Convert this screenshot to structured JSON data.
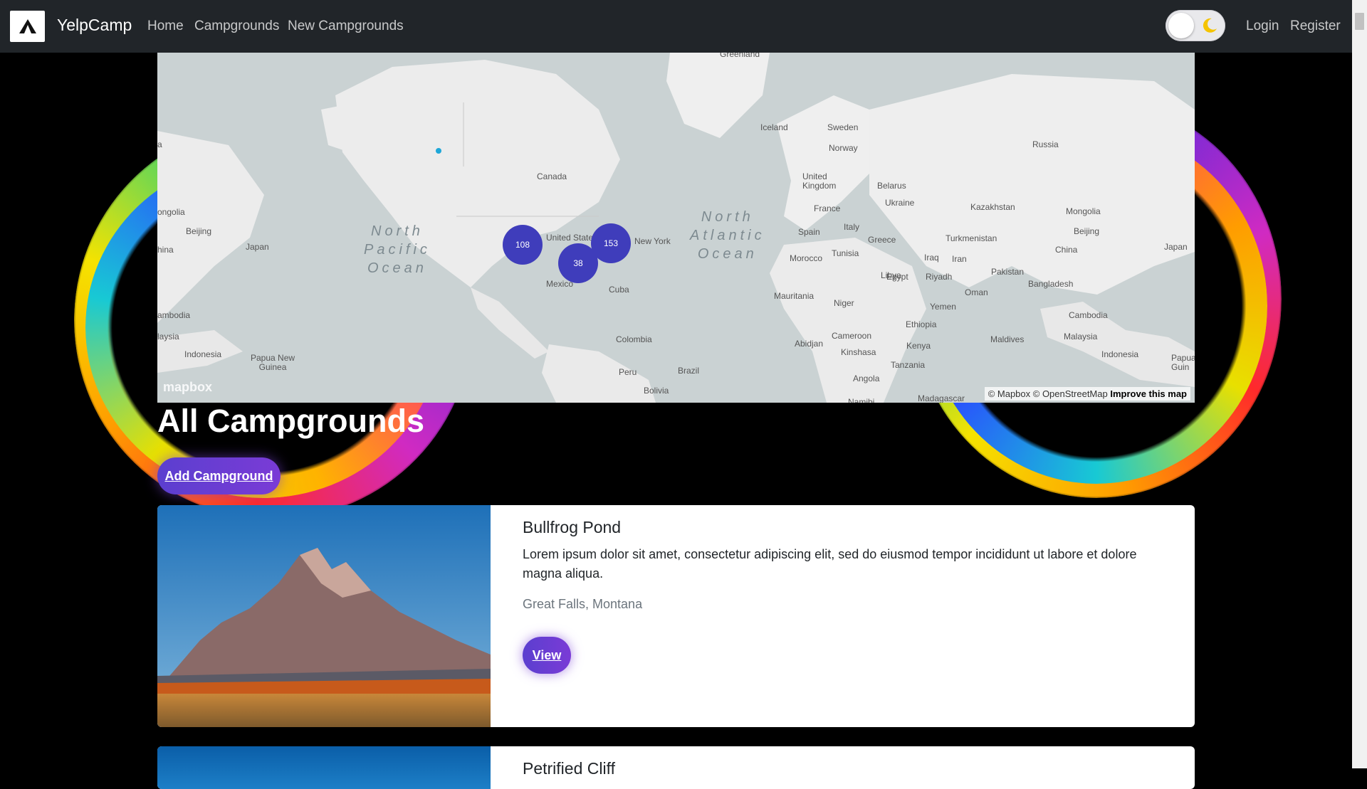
{
  "navbar": {
    "brand": "YelpCamp",
    "links": [
      "Home",
      "Campgrounds",
      "New Campgrounds"
    ],
    "login": "Login",
    "register": "Register",
    "logo_icon": "tent-icon",
    "theme_toggle_icon": "moon-icon"
  },
  "map": {
    "place_labels": {
      "greenland": "Greenland",
      "iceland": "Iceland",
      "sweden": "Sweden",
      "norway": "Norway",
      "russia": "Russia",
      "canada": "Canada",
      "uk": "United\nKingdom",
      "belarus": "Belarus",
      "ukraine": "Ukraine",
      "kazakhstan": "Kazakhstan",
      "mongolia_r": "Mongolia",
      "mongolia_l": "ongolia",
      "france": "France",
      "italy": "Italy",
      "spain": "Spain",
      "greece": "Greece",
      "turkmenistan": "Turkmenistan",
      "beijing_r": "Beijing",
      "beijing_l": "Beijing",
      "japan_r": "Japan",
      "japan_l": "Japan",
      "china_r": "China",
      "china_l": "hina",
      "united_states": "United State",
      "new_york": "New York",
      "morocco": "Morocco",
      "tunisia": "Tunisia",
      "iraq": "Iraq",
      "iran": "Iran",
      "pakistan": "Pakistan",
      "mexico": "Mexico",
      "cuba": "Cuba",
      "libya": "Libya",
      "egypt": "Egypt",
      "riyadh": "Riyadh",
      "oman": "Oman",
      "bangladesh": "Bangladesh",
      "mauritania": "Mauritania",
      "niger": "Niger",
      "yemen": "Yemen",
      "cambodia_r": "Cambodia",
      "cambodia_l": "ambodia",
      "ethiopia": "Ethiopia",
      "colombia": "Colombia",
      "cameroon": "Cameroon",
      "abidjan": "Abidjan",
      "kenya": "Kenya",
      "maldives": "Maldives",
      "malaysia_r": "Malaysia",
      "malaysia_l": "laysia",
      "indonesia_l": "Indonesia",
      "indonesia_r": "Indonesia",
      "papua_l": "Papua New\nGuinea",
      "papua_r": "Papua\nGuin",
      "kinshasa": "Kinshasa",
      "tanzania": "Tanzania",
      "peru": "Peru",
      "brazil": "Brazil",
      "bolivia": "Bolivia",
      "angola": "Angola",
      "madagascar": "Madagascar",
      "namibia": "Namibi",
      "edge_a": "a"
    },
    "oceans": {
      "north_pacific": "North\nPacific\nOcean",
      "north_atlantic": "North\nAtlantic\nOcean"
    },
    "clusters": [
      {
        "count": "108"
      },
      {
        "count": "38"
      },
      {
        "count": "153"
      }
    ],
    "compass_icon": "compass-icon",
    "logo": "mapbox",
    "attribution": "© Mapbox © OpenStreetMap",
    "improve": "Improve this map"
  },
  "page": {
    "title": "All Campgrounds",
    "add_button": "Add Campground"
  },
  "campgrounds": [
    {
      "title": "Bullfrog Pond",
      "description": "Lorem ipsum dolor sit amet, consectetur adipiscing elit, sed do eiusmod tempor incididunt ut labore et dolore magna aliqua.",
      "location": "Great Falls, Montana",
      "button": "View"
    },
    {
      "title": "Petrified Cliff"
    }
  ],
  "colors": {
    "navbar": "#212529",
    "button_gradient_start": "#5b3fcf",
    "button_gradient_end": "#7a3bd6",
    "cluster": "#3f3dbb"
  }
}
